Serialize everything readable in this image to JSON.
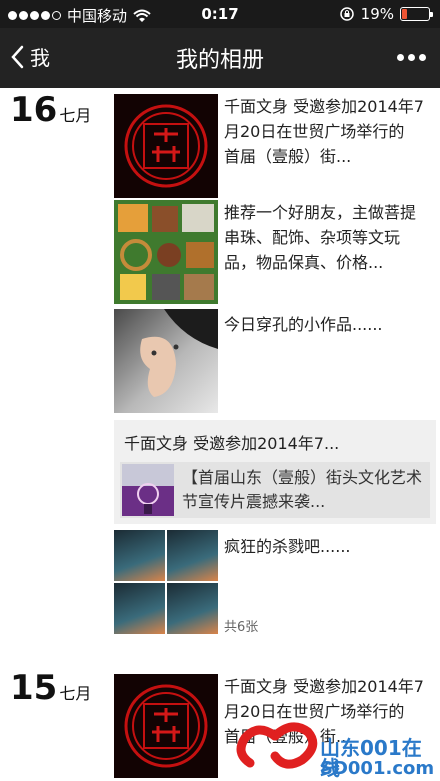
{
  "status_bar": {
    "carrier": "中国移动",
    "time": "0:17",
    "battery": "19%",
    "battery_level": 0.19
  },
  "nav": {
    "back_label": "我",
    "title": "我的相册"
  },
  "days": [
    {
      "day": "16",
      "month": "七月"
    },
    {
      "day": "15",
      "month": "七月"
    }
  ],
  "posts": [
    {
      "text": "千面文身 受邀参加2014年7月20日在世贸广场举行的 首届（壹般）街..."
    },
    {
      "text": "推荐一个好朋友，主做菩提串珠、配饰、杂项等文玩品，物品保真、价格..."
    },
    {
      "text": "今日穿孔的小作品......"
    },
    {
      "text": "疯狂的杀戮吧......",
      "photo_count": "共6张"
    },
    {
      "text": "千面文身 受邀参加2014年7月20日在世贸广场举行的 首届（壹般）街..."
    }
  ],
  "share": {
    "title": "千面文身 受邀参加2014年7...",
    "link_text": "【首届山东（壹般）街头文化艺术节宣传片震撼来袭..."
  },
  "watermark": {
    "text": "山东001在线",
    "sub": "SD001.com"
  }
}
